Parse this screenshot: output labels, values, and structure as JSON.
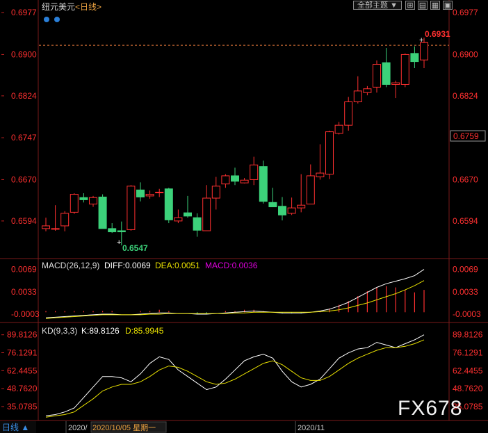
{
  "header": {
    "symbol_name": "纽元美元",
    "period_label": "<日线>",
    "theme_select": "全部主题",
    "theme_arrow": "▼"
  },
  "price_axis": {
    "ticks": [
      "0.6977",
      "0.6900",
      "0.6824",
      "0.6747",
      "0.6670",
      "0.6594"
    ],
    "right_tag": "0.6759"
  },
  "annotations": {
    "high_label": "0.6931",
    "low_label": "0.6547"
  },
  "macd_panel": {
    "title": "MACD(26,12,9)",
    "diff_label": "DIFF:0.0069",
    "dea_label": "DEA:0.0051",
    "macd_label": "MACD:0.0036",
    "ticks": [
      "0.0069",
      "0.0033",
      "-0.0003"
    ]
  },
  "kd_panel": {
    "title": "KD(9,3,3)",
    "k_label": "K:89.8126",
    "d_label": "D:85.9945",
    "ticks": [
      "89.8126",
      "76.1291",
      "62.4455",
      "48.7620",
      "35.0785"
    ]
  },
  "footer": {
    "period_button": "日线 ▲",
    "date_label_1": "2020/",
    "date_label_2": "2020/10/05 星期一",
    "date_label_3": "2020/11"
  },
  "watermark": "FX678",
  "colors": {
    "up": "#ff3030",
    "down": "#3cd27a",
    "axis_text": "#ff3030",
    "macd_white": "#ffffff",
    "dea_yellow": "#e8e000",
    "macd_magenta": "#e000e0",
    "dash_line": "#e87a3a"
  },
  "chart_data": [
    {
      "type": "candlestick",
      "title": "纽元美元<日线>",
      "ylim": [
        0.653,
        0.699
      ],
      "ticks": [
        0.6977,
        0.69,
        0.6824,
        0.6747,
        0.667,
        0.6594
      ],
      "reference_line": 0.6917,
      "candles": [
        {
          "o": 0.658,
          "h": 0.66,
          "l": 0.6575,
          "c": 0.6585
        },
        {
          "o": 0.658,
          "h": 0.6623,
          "l": 0.6576,
          "c": 0.658
        },
        {
          "o": 0.6585,
          "h": 0.6612,
          "l": 0.6575,
          "c": 0.6608
        },
        {
          "o": 0.661,
          "h": 0.6645,
          "l": 0.6607,
          "c": 0.6643
        },
        {
          "o": 0.6637,
          "h": 0.6645,
          "l": 0.6628,
          "c": 0.6633
        },
        {
          "o": 0.6625,
          "h": 0.664,
          "l": 0.662,
          "c": 0.6637
        },
        {
          "o": 0.6638,
          "h": 0.6643,
          "l": 0.658,
          "c": 0.658
        },
        {
          "o": 0.658,
          "h": 0.659,
          "l": 0.6572,
          "c": 0.6574
        },
        {
          "o": 0.6576,
          "h": 0.6593,
          "l": 0.6549,
          "c": 0.6574
        },
        {
          "o": 0.6578,
          "h": 0.666,
          "l": 0.6576,
          "c": 0.6658
        },
        {
          "o": 0.6651,
          "h": 0.6665,
          "l": 0.663,
          "c": 0.6638
        },
        {
          "o": 0.664,
          "h": 0.665,
          "l": 0.6635,
          "c": 0.6643
        },
        {
          "o": 0.6647,
          "h": 0.6653,
          "l": 0.6638,
          "c": 0.6647
        },
        {
          "o": 0.6653,
          "h": 0.6655,
          "l": 0.659,
          "c": 0.6596
        },
        {
          "o": 0.6594,
          "h": 0.6615,
          "l": 0.659,
          "c": 0.66
        },
        {
          "o": 0.6609,
          "h": 0.664,
          "l": 0.66,
          "c": 0.6603
        },
        {
          "o": 0.66,
          "h": 0.6608,
          "l": 0.6565,
          "c": 0.6577
        },
        {
          "o": 0.6576,
          "h": 0.666,
          "l": 0.6576,
          "c": 0.6636
        },
        {
          "o": 0.6636,
          "h": 0.6675,
          "l": 0.6615,
          "c": 0.6658
        },
        {
          "o": 0.6662,
          "h": 0.668,
          "l": 0.6655,
          "c": 0.6677
        },
        {
          "o": 0.6677,
          "h": 0.6692,
          "l": 0.666,
          "c": 0.6667
        },
        {
          "o": 0.6664,
          "h": 0.6673,
          "l": 0.6663,
          "c": 0.6669
        },
        {
          "o": 0.667,
          "h": 0.6712,
          "l": 0.666,
          "c": 0.6697
        },
        {
          "o": 0.6694,
          "h": 0.6705,
          "l": 0.6626,
          "c": 0.663
        },
        {
          "o": 0.6628,
          "h": 0.6655,
          "l": 0.662,
          "c": 0.662
        },
        {
          "o": 0.6621,
          "h": 0.6638,
          "l": 0.6595,
          "c": 0.6605
        },
        {
          "o": 0.6608,
          "h": 0.6637,
          "l": 0.6605,
          "c": 0.6618
        },
        {
          "o": 0.6618,
          "h": 0.668,
          "l": 0.661,
          "c": 0.6623
        },
        {
          "o": 0.6625,
          "h": 0.6698,
          "l": 0.6625,
          "c": 0.6677
        },
        {
          "o": 0.6675,
          "h": 0.6735,
          "l": 0.667,
          "c": 0.6682
        },
        {
          "o": 0.668,
          "h": 0.676,
          "l": 0.6671,
          "c": 0.6758
        },
        {
          "o": 0.6755,
          "h": 0.6776,
          "l": 0.6753,
          "c": 0.677
        },
        {
          "o": 0.677,
          "h": 0.6822,
          "l": 0.676,
          "c": 0.6813
        },
        {
          "o": 0.6813,
          "h": 0.686,
          "l": 0.681,
          "c": 0.6833
        },
        {
          "o": 0.683,
          "h": 0.6842,
          "l": 0.6825,
          "c": 0.6837
        },
        {
          "o": 0.684,
          "h": 0.6889,
          "l": 0.683,
          "c": 0.6882
        },
        {
          "o": 0.6885,
          "h": 0.6912,
          "l": 0.684,
          "c": 0.6845
        },
        {
          "o": 0.6845,
          "h": 0.6852,
          "l": 0.682,
          "c": 0.6848
        },
        {
          "o": 0.6845,
          "h": 0.6902,
          "l": 0.684,
          "c": 0.69
        },
        {
          "o": 0.6902,
          "h": 0.6915,
          "l": 0.6875,
          "c": 0.6887
        },
        {
          "o": 0.689,
          "h": 0.6931,
          "l": 0.6875,
          "c": 0.6922
        }
      ]
    },
    {
      "type": "macd",
      "title": "MACD(26,12,9)",
      "ylim": [
        -0.0012,
        0.0082
      ],
      "ticks": [
        0.0069,
        0.0033,
        -0.0003
      ],
      "series": [
        {
          "name": "DIFF",
          "values": [
            -0.0009,
            -0.0008,
            -0.0007,
            -0.0006,
            -0.0005,
            -0.0004,
            -0.0003,
            -0.0003,
            -0.0004,
            -0.0004,
            -0.0003,
            -0.0002,
            -0.0001,
            -0.0001,
            -0.0002,
            -0.0002,
            -0.0003,
            -0.0003,
            -0.0002,
            -0.0001,
            0.0,
            0.0001,
            0.0002,
            0.0001,
            0.0,
            -0.0001,
            -0.0001,
            -0.0001,
            0.0,
            0.0002,
            0.0005,
            0.001,
            0.0016,
            0.0024,
            0.0032,
            0.004,
            0.0046,
            0.005,
            0.0054,
            0.0059,
            0.0069
          ]
        },
        {
          "name": "DEA",
          "values": [
            -0.001,
            -0.0009,
            -0.0008,
            -0.0007,
            -0.0006,
            -0.0005,
            -0.0004,
            -0.0004,
            -0.0004,
            -0.0004,
            -0.0004,
            -0.0003,
            -0.0003,
            -0.0002,
            -0.0002,
            -0.0002,
            -0.0002,
            -0.0002,
            -0.0002,
            -0.0002,
            -0.0001,
            -0.0001,
            0.0,
            0.0,
            0.0,
            0.0,
            0.0,
            0.0,
            0.0,
            0.0001,
            0.0002,
            0.0004,
            0.0007,
            0.0011,
            0.0015,
            0.002,
            0.0025,
            0.003,
            0.0036,
            0.0043,
            0.0051
          ]
        },
        {
          "name": "MACD",
          "values": [
            0.0002,
            0.0002,
            0.0002,
            0.0002,
            0.0002,
            0.0002,
            0.0002,
            0.0002,
            0.0,
            0.0,
            0.0002,
            0.0002,
            0.0004,
            0.0002,
            0.0,
            0.0,
            -0.0002,
            -0.0002,
            0.0,
            0.0002,
            0.0002,
            0.0004,
            0.0004,
            0.0002,
            0.0,
            -0.0002,
            -0.0002,
            -0.0002,
            0.0,
            0.0002,
            0.0006,
            0.0012,
            0.0018,
            0.0026,
            0.0034,
            0.004,
            0.0042,
            0.004,
            0.0036,
            0.0032,
            0.0036
          ]
        }
      ]
    },
    {
      "type": "line",
      "title": "KD(9,3,3)",
      "ylim": [
        25,
        96
      ],
      "ticks": [
        89.8126,
        76.1291,
        62.4455,
        48.762,
        35.0785
      ],
      "series": [
        {
          "name": "K",
          "values": [
            28,
            29,
            31,
            34,
            42,
            50,
            58,
            58,
            57,
            54,
            60,
            68,
            73,
            71,
            63,
            58,
            53,
            48,
            50,
            56,
            63,
            70,
            73,
            75,
            72,
            62,
            54,
            50,
            52,
            56,
            64,
            72,
            76,
            79,
            80,
            84,
            82,
            80,
            83,
            86,
            89.8126
          ]
        },
        {
          "name": "D",
          "values": [
            27,
            28,
            29,
            31,
            36,
            41,
            47,
            50,
            52,
            52,
            54,
            58,
            63,
            66,
            65,
            62,
            58,
            54,
            52,
            53,
            56,
            60,
            64,
            68,
            70,
            67,
            62,
            57,
            55,
            55,
            58,
            63,
            68,
            72,
            75,
            78,
            80,
            80,
            81,
            83,
            85.9945
          ]
        }
      ]
    }
  ]
}
